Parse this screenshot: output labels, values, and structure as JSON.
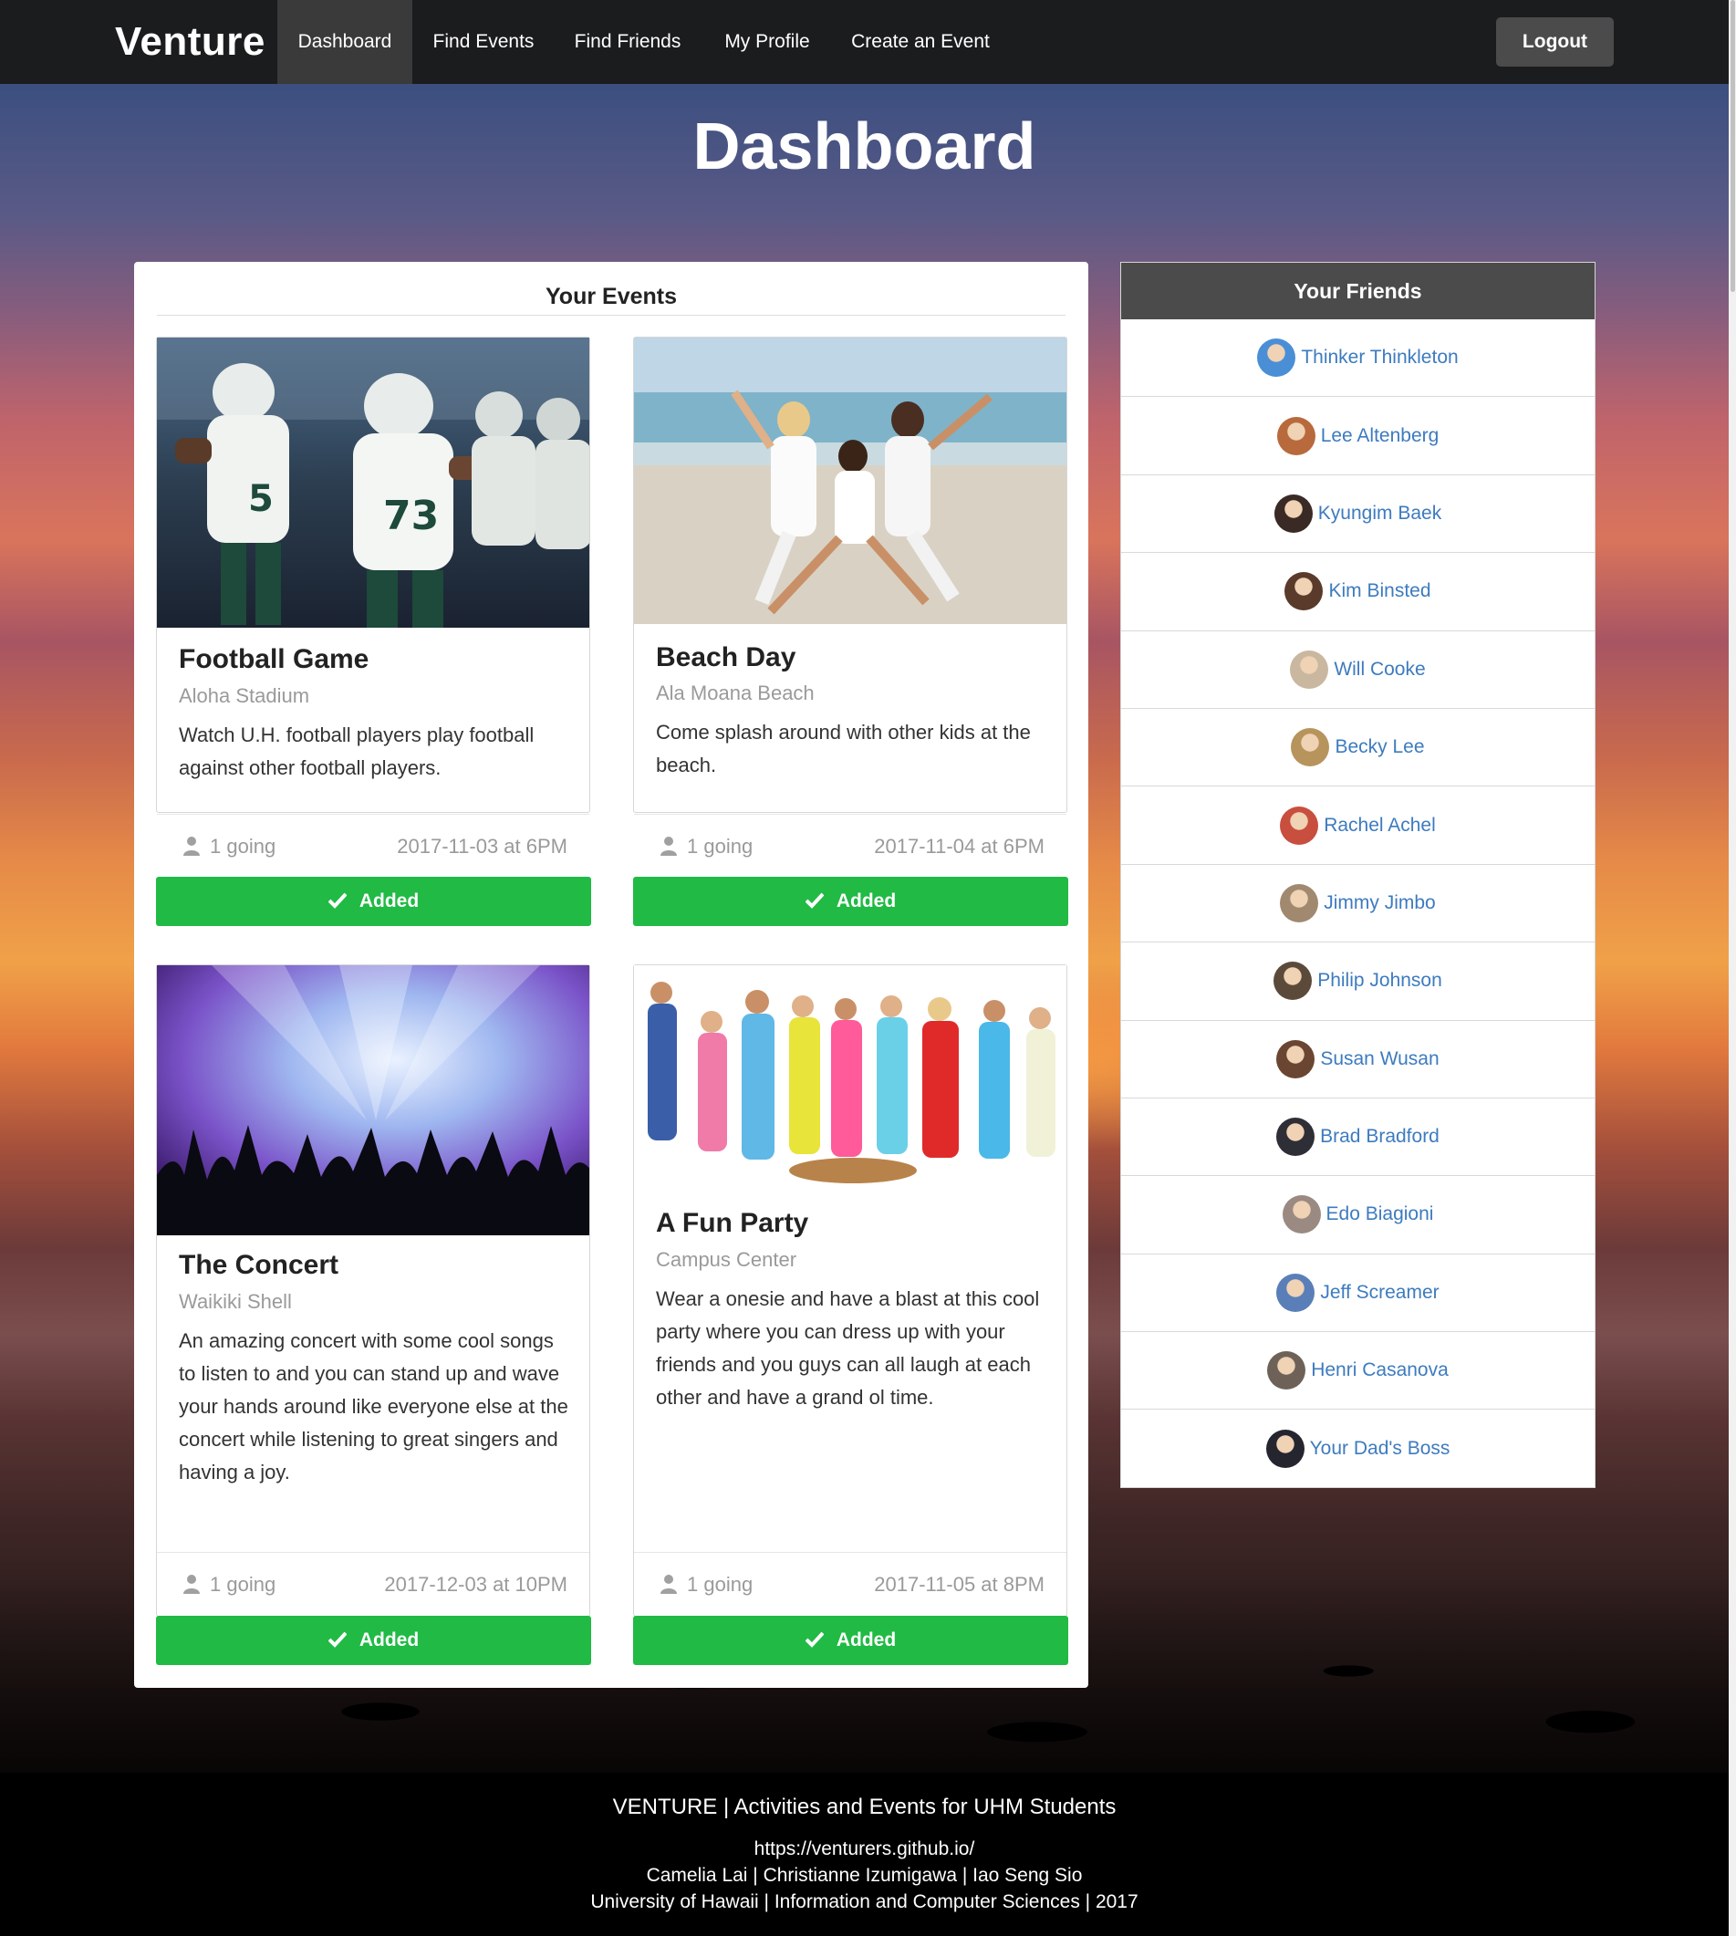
{
  "nav": {
    "brand": "Venture",
    "items": [
      {
        "label": "Dashboard",
        "active": true
      },
      {
        "label": "Find Events"
      },
      {
        "label": "Find Friends"
      },
      {
        "label": "My Profile"
      },
      {
        "label": "Create an Event"
      }
    ],
    "logout": "Logout"
  },
  "page": {
    "title": "Dashboard"
  },
  "events": {
    "heading": "Your Events",
    "cards": [
      {
        "title": "Football Game",
        "location": "Aloha Stadium",
        "description": "Watch U.H. football players play football against other football players.",
        "going": "1 going",
        "date": "2017-11-03 at 6PM",
        "button": "Added",
        "image_icon": "football-players-photo"
      },
      {
        "title": "Beach Day",
        "location": "Ala Moana Beach",
        "description": "Come splash around with other kids at the beach.",
        "going": "1 going",
        "date": "2017-11-04 at 6PM",
        "button": "Added",
        "image_icon": "beach-people-photo"
      },
      {
        "title": "The Concert",
        "location": "Waikiki Shell",
        "description": "An amazing concert with some cool songs to listen to and you can stand up and wave your hands around like everyone else at the concert while listening to great singers and having a joy.",
        "going": "1 going",
        "date": "2017-12-03 at 10PM",
        "button": "Added",
        "image_icon": "concert-crowd-photo"
      },
      {
        "title": "A Fun Party",
        "location": "Campus Center",
        "description": "Wear a onesie and have a blast at this cool party where you can dress up with your friends and you guys can all laugh at each other and have a grand ol time.",
        "going": "1 going",
        "date": "2017-11-05 at 8PM",
        "button": "Added",
        "image_icon": "onesie-party-photo"
      }
    ]
  },
  "friends": {
    "heading": "Your Friends",
    "list": [
      {
        "name": "Thinker Thinkleton",
        "color": "#4a8fd6"
      },
      {
        "name": "Lee Altenberg",
        "color": "#b86a3c"
      },
      {
        "name": "Kyungim Baek",
        "color": "#3a2a25"
      },
      {
        "name": "Kim Binsted",
        "color": "#5a3a2a"
      },
      {
        "name": "Will Cooke",
        "color": "#c9b7a0"
      },
      {
        "name": "Becky Lee",
        "color": "#b7945c"
      },
      {
        "name": "Rachel Achel",
        "color": "#c84e3e"
      },
      {
        "name": "Jimmy Jimbo",
        "color": "#a0896e"
      },
      {
        "name": "Philip Johnson",
        "color": "#5b4a3a"
      },
      {
        "name": "Susan Wusan",
        "color": "#6a4632"
      },
      {
        "name": "Brad Bradford",
        "color": "#2e2e36"
      },
      {
        "name": "Edo Biagioni",
        "color": "#9a8a82"
      },
      {
        "name": "Jeff Screamer",
        "color": "#5a7fb8"
      },
      {
        "name": "Henri Casanova",
        "color": "#6e6258"
      },
      {
        "name": "Your Dad's Boss",
        "color": "#252530"
      }
    ]
  },
  "footer": {
    "line1": "VENTURE | Activities and Events for UHM Students",
    "line2": "https://venturers.github.io/",
    "line3": "Camelia Lai | Christianne Izumigawa | Iao Seng Sio",
    "line4": "University of Hawaii | Information and Computer Sciences | 2017"
  },
  "colors": {
    "navbar": "#1b1c1d",
    "accent_green": "#21ba45",
    "link_blue": "#3d7bbf"
  }
}
